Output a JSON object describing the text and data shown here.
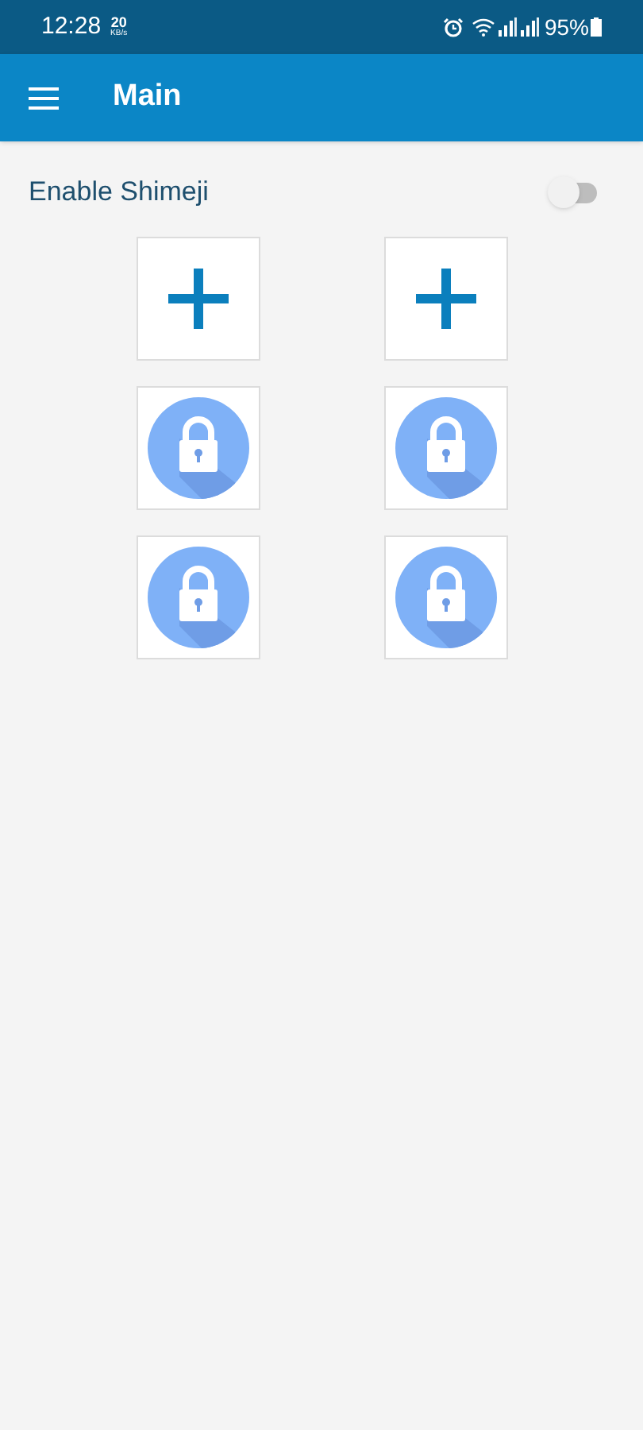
{
  "status_bar": {
    "time": "12:28",
    "speed": "20",
    "speed_unit": "KB/s",
    "battery": "95%"
  },
  "app_bar": {
    "title": "Main"
  },
  "enable_setting": {
    "label": "Enable Shimeji",
    "on": false
  },
  "slots": [
    {
      "kind": "add"
    },
    {
      "kind": "add"
    },
    {
      "kind": "locked"
    },
    {
      "kind": "locked"
    },
    {
      "kind": "locked"
    },
    {
      "kind": "locked"
    }
  ]
}
